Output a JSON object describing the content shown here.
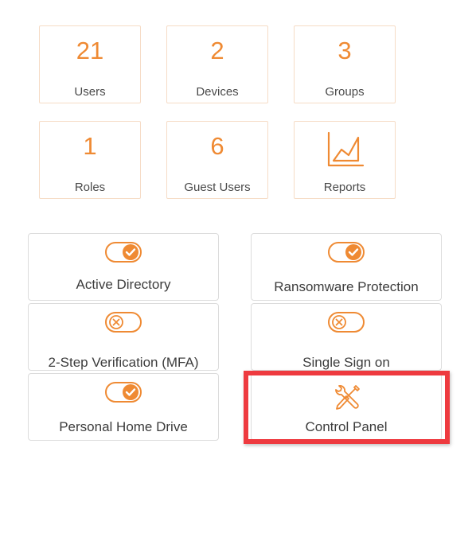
{
  "stats": {
    "users": {
      "value": "21",
      "label": "Users"
    },
    "devices": {
      "value": "2",
      "label": "Devices"
    },
    "groups": {
      "value": "3",
      "label": "Groups"
    },
    "roles": {
      "value": "1",
      "label": "Roles"
    },
    "guest_users": {
      "value": "6",
      "label": "Guest Users"
    },
    "reports": {
      "label": "Reports",
      "icon": "line-chart-icon"
    }
  },
  "features": {
    "active_directory": {
      "label": "Active Directory",
      "enabled": true,
      "icon": "toggle-on-icon"
    },
    "ransomware_protection": {
      "label": "Ransomware Protection",
      "enabled": true,
      "icon": "toggle-on-icon"
    },
    "two_step_verification": {
      "label": "2-Step Verification (MFA)",
      "enabled": false,
      "icon": "toggle-off-icon"
    },
    "single_sign_on": {
      "label": "Single Sign on",
      "enabled": false,
      "icon": "toggle-off-icon"
    },
    "personal_home_drive": {
      "label": "Personal Home Drive",
      "enabled": true,
      "icon": "toggle-on-icon"
    },
    "control_panel": {
      "label": "Control Panel",
      "icon": "tools-icon"
    }
  },
  "colors": {
    "accent": "#ef8a33",
    "highlight": "#ee3a3f",
    "border": "#dcdcdc"
  }
}
